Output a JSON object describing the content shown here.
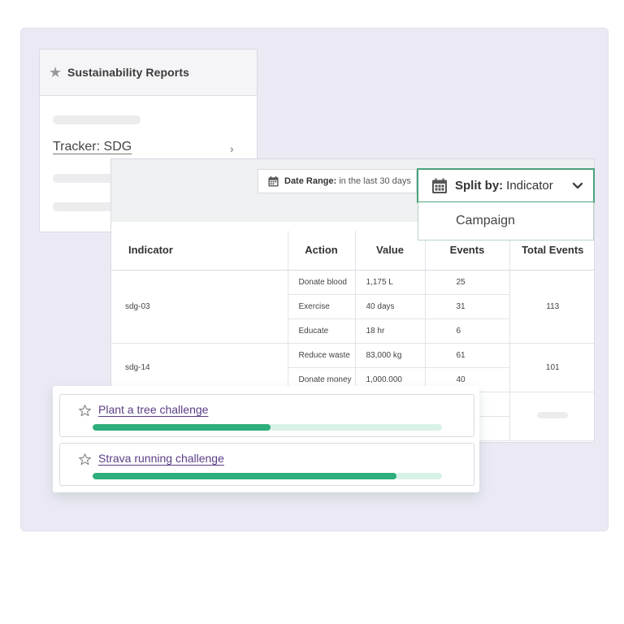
{
  "reports": {
    "title": "Sustainability Reports",
    "tracker_link": "Tracker: SDG"
  },
  "toolbar": {
    "date_range_label": "Date Range:",
    "date_range_value": "in the last 30 days",
    "split_label": "Split by:",
    "split_value": "Indicator",
    "split_options": [
      "Campaign"
    ]
  },
  "table": {
    "headers": [
      "Indicator",
      "Action",
      "Value",
      "Events",
      "Total Events"
    ],
    "groups": [
      {
        "indicator": "sdg-03",
        "total": "113",
        "rows": [
          {
            "action": "Donate blood",
            "value": "1,175 L",
            "events": "25"
          },
          {
            "action": "Exercise",
            "value": "40 days",
            "events": "31"
          },
          {
            "action": "Educate",
            "value": "18 hr",
            "events": "6"
          }
        ]
      },
      {
        "indicator": "sdg-14",
        "total": "101",
        "rows": [
          {
            "action": "Reduce waste",
            "value": "83,000 kg",
            "events": "61"
          },
          {
            "action": "Donate money",
            "value": "1,000.000",
            "events": "40"
          }
        ]
      }
    ]
  },
  "challenges": [
    {
      "name": "Plant a tree challenge",
      "progress": 0.51
    },
    {
      "name": "Strava running challenge",
      "progress": 0.87
    }
  ],
  "colors": {
    "accent": "#2dae7a",
    "track": "#d9f2e8",
    "link": "#5a3e86",
    "focus_border": "#4aa37c"
  }
}
